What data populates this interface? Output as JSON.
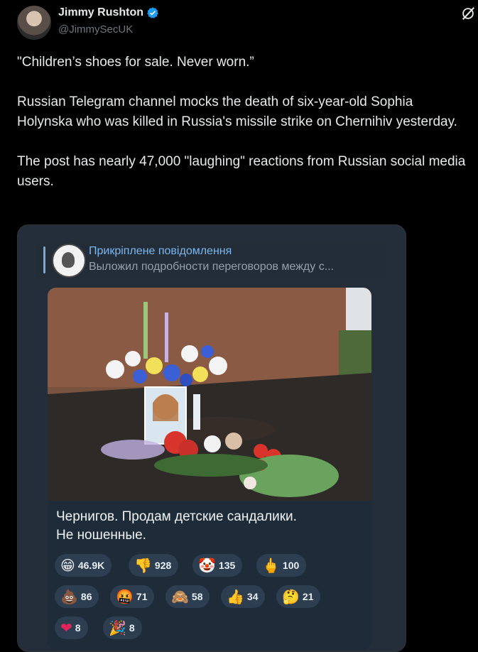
{
  "author": {
    "name": "Jimmy Rushton",
    "handle": "@JimmySecUK"
  },
  "icons": {
    "verified": "verified-badge-icon",
    "grok": "grok-icon"
  },
  "tweet": {
    "p1": "\"Children’s shoes for sale. Never worn.”",
    "p2": "Russian Telegram channel mocks the death of six-year-old Sophia Holynska who was killed in Russia's missile strike on Chernihiv yesterday.",
    "p3": "The post has nearly 47,000 \"laughing\" reactions from Russian social media users."
  },
  "telegram": {
    "pinned_title": "Прикріплене повідомлення",
    "pinned_text": "Выложил подробности переговоров между с...",
    "caption_line1": "Чернигов. Продам детские сандалики.",
    "caption_line2": "Не ношенные.",
    "reactions": [
      {
        "emoji": "😁",
        "count": "46.9K"
      },
      {
        "emoji": "👎",
        "count": "928"
      },
      {
        "emoji": "🤡",
        "count": "135"
      },
      {
        "emoji": "🖕",
        "count": "100"
      },
      {
        "emoji": "💩",
        "count": "86"
      },
      {
        "emoji": "🤬",
        "count": "71"
      },
      {
        "emoji": "🙈",
        "count": "58"
      },
      {
        "emoji": "👍",
        "count": "34"
      },
      {
        "emoji": "🤔",
        "count": "21"
      },
      {
        "emoji": "❤",
        "count": "8"
      },
      {
        "emoji": "🎉",
        "count": "8"
      }
    ]
  },
  "colors": {
    "background": "#000000",
    "text": "#e7e9ea",
    "secondary": "#71767b",
    "verified": "#1d9bf0",
    "telegram_link": "#7cb6ee"
  }
}
